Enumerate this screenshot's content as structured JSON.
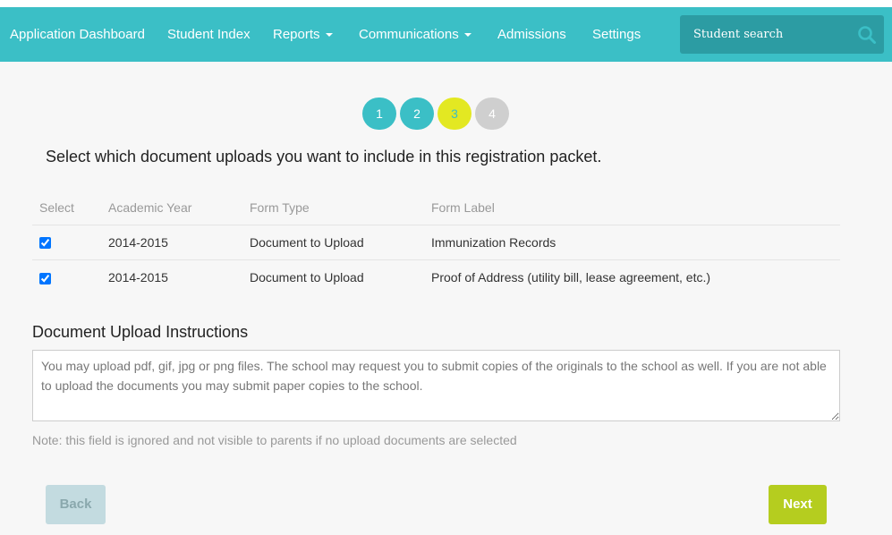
{
  "navbar": {
    "items": [
      {
        "label": "Application Dashboard",
        "dropdown": false
      },
      {
        "label": "Student Index",
        "dropdown": false
      },
      {
        "label": "Reports",
        "dropdown": true
      },
      {
        "label": "Communications",
        "dropdown": true
      },
      {
        "label": "Admissions",
        "dropdown": false
      },
      {
        "label": "Settings",
        "dropdown": false
      }
    ],
    "search": {
      "placeholder": "Student search",
      "icon": "search-icon"
    }
  },
  "steps": [
    {
      "label": "1",
      "state": "complete"
    },
    {
      "label": "2",
      "state": "complete"
    },
    {
      "label": "3",
      "state": "current"
    },
    {
      "label": "4",
      "state": "pending"
    }
  ],
  "prompt": "Select which document uploads you want to include in this registration packet.",
  "table": {
    "headers": [
      "Select",
      "Academic Year",
      "Form Type",
      "Form Label"
    ],
    "rows": [
      {
        "checked": true,
        "year": "2014-2015",
        "type": "Document to Upload",
        "label": "Immunization Records"
      },
      {
        "checked": true,
        "year": "2014-2015",
        "type": "Document to Upload",
        "label": "Proof of Address (utility bill, lease agreement, etc.)"
      }
    ]
  },
  "instructions": {
    "title": "Document Upload Instructions",
    "value": "You may upload pdf, gif, jpg or png files. The school may request you to submit copies of the originals to the school as well. If you are not able to upload the documents you may submit paper copies to the school.",
    "note": "Note: this field is ignored and not visible to parents if no upload documents are selected"
  },
  "buttons": {
    "back": "Back",
    "next": "Next"
  },
  "colors": {
    "brand": "#3bbfc6",
    "current_step": "#e3e822",
    "next_button": "#b5cd1f",
    "back_button": "#c3dbe0"
  }
}
